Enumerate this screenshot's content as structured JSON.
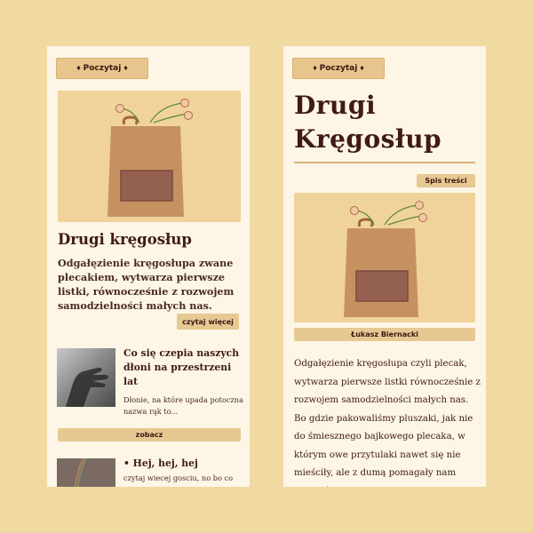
{
  "left": {
    "poczytaj_button": "Poczytaj",
    "article": {
      "title": "Drugi kręgosłup",
      "description": "Odgałęzienie kręgosłupa zwane plecakiem, wytwarza pierwsze listki, równocześnie z rozwojem samodzielności małych nas.",
      "read_more": "czytaj więcej"
    },
    "cards": [
      {
        "title": "Co się czepia naszych dłoni na przestrzeni lat",
        "excerpt": "Dłonie, na które upada potoczna nazwa rąk to...",
        "button": "zobacz"
      },
      {
        "title": "• Hej, hej, hej",
        "excerpt": "czytaj wiecej gosciu, no bo co"
      }
    ]
  },
  "right": {
    "poczytaj_button": "Poczytaj",
    "title_line1": "Drugi",
    "title_line2": "Kręgosłup",
    "toc_button": "Spis treści",
    "author": "Łukasz Biernacki",
    "body": "Odgałęzienie kręgosłupa czyli plecak, wytwarza pierwsze listki równocześnie z rozwojem samodzielności małych nas. Bo gdzie pakowaliśmy pluszaki, jak nie do śmiesznego bajkowego plecaka, w którym owe przytulaki nawet się nie mieściły, ale z dumą pomagały nam stawiać pierwsze kroki."
  },
  "colors": {
    "background": "#f1d9a2",
    "panel": "#fdf6e6",
    "accent": "#e6c892",
    "text": "#3f1a16"
  }
}
